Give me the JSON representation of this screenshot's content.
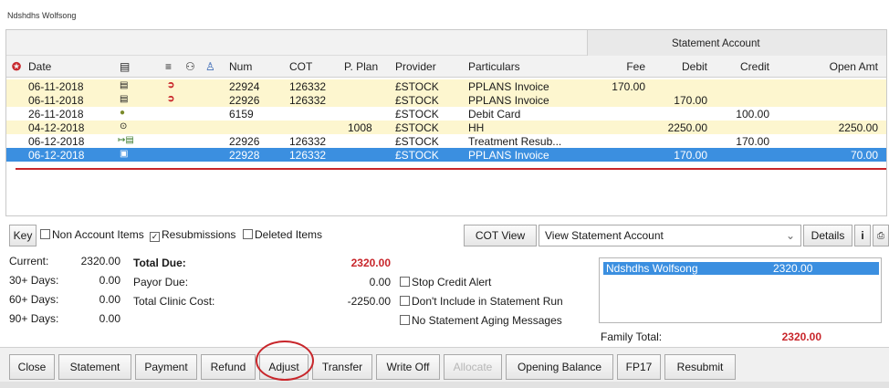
{
  "window": {
    "title": "Ndshdhs Wolfsong"
  },
  "grid": {
    "group_header": "Statement Account",
    "columns": [
      "Date",
      "Num",
      "COT",
      "P. Plan",
      "Provider",
      "Particulars",
      "Fee",
      "Debit",
      "Credit",
      "Open Amt"
    ],
    "rows": [
      {
        "date": "06-11-2018",
        "num": "22924",
        "cot": "126332",
        "pplan": "",
        "provider": "£STOCK",
        "particulars": "PPLANS Invoice",
        "fee": "170.00",
        "debit": "",
        "credit": "",
        "open": ""
      },
      {
        "date": "06-11-2018",
        "num": "22926",
        "cot": "126332",
        "pplan": "",
        "provider": "£STOCK",
        "particulars": "PPLANS Invoice",
        "fee": "",
        "debit": "170.00",
        "credit": "",
        "open": ""
      },
      {
        "date": "26-11-2018",
        "num": "6159",
        "cot": "",
        "pplan": "",
        "provider": "£STOCK",
        "particulars": "Debit Card",
        "fee": "",
        "debit": "",
        "credit": "100.00",
        "open": ""
      },
      {
        "date": "04-12-2018",
        "num": "",
        "cot": "",
        "pplan": "1008",
        "provider": "£STOCK",
        "particulars": "HH",
        "fee": "",
        "debit": "2250.00",
        "credit": "",
        "open": "2250.00"
      },
      {
        "date": "06-12-2018",
        "num": "22926",
        "cot": "126332",
        "pplan": "",
        "provider": "£STOCK",
        "particulars": "Treatment Resub...",
        "fee": "",
        "debit": "",
        "credit": "170.00",
        "open": ""
      },
      {
        "date": "06-12-2018",
        "num": "22928",
        "cot": "126332",
        "pplan": "",
        "provider": "£STOCK",
        "particulars": "PPLANS Invoice",
        "fee": "",
        "debit": "170.00",
        "credit": "",
        "open": "70.00"
      }
    ]
  },
  "keybar": {
    "key_label": "Key",
    "non_account": "Non Account Items",
    "resubmissions": "Resubmissions",
    "deleted": "Deleted Items",
    "cot_view": "COT View",
    "view_select": "View Statement Account",
    "details": "Details"
  },
  "summary": {
    "current_label": "Current:",
    "current_value": "2320.00",
    "d30_label": "30+ Days:",
    "d30_value": "0.00",
    "d60_label": "60+ Days:",
    "d60_value": "0.00",
    "d90_label": "90+ Days:",
    "d90_value": "0.00",
    "total_due_label": "Total Due:",
    "total_due_value": "2320.00",
    "payor_due_label": "Payor Due:",
    "payor_due_value": "0.00",
    "clinic_cost_label": "Total Clinic Cost:",
    "clinic_cost_value": "-2250.00",
    "stop_credit": "Stop Credit Alert",
    "dont_include": "Don't Include in Statement Run",
    "no_aging": "No Statement Aging Messages"
  },
  "family": {
    "name": "Ndshdhs Wolfsong",
    "amount": "2320.00",
    "total_label": "Family Total:",
    "total_value": "2320.00"
  },
  "buttons": {
    "close": "Close",
    "statement": "Statement",
    "payment": "Payment",
    "refund": "Refund",
    "adjust": "Adjust",
    "transfer": "Transfer",
    "write_off": "Write Off",
    "allocate": "Allocate",
    "opening_balance": "Opening Balance",
    "fp17": "FP17",
    "resubmit": "Resubmit"
  },
  "colors": {
    "accent_red": "#c8262b",
    "selection_blue": "#3b8fe0",
    "row_highlight": "#fdf6cf"
  }
}
